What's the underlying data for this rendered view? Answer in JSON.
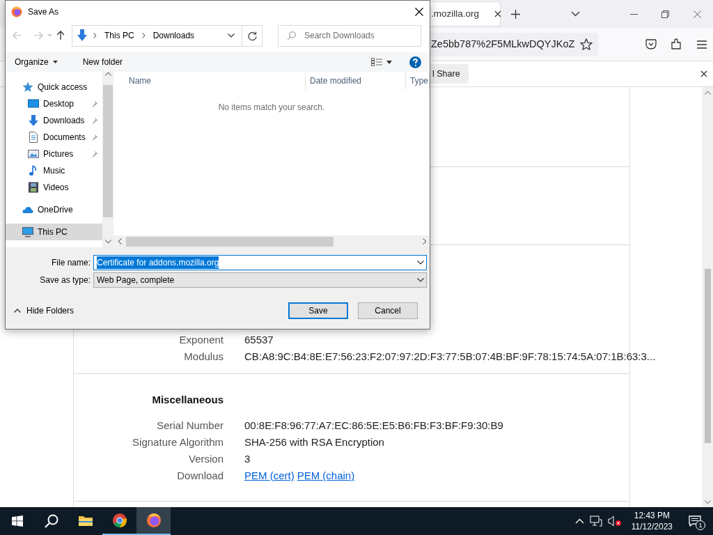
{
  "browser": {
    "tab": {
      "title": ".mozilla.org"
    },
    "url_fragment": "Ze5bb787%2F5MLkwDQYJKoZ",
    "notification": {
      "button": "l Share"
    }
  },
  "page": {
    "key_rows": [
      {
        "label": "Exponent",
        "value": "65537"
      },
      {
        "label": "Modulus",
        "value": "CB:A8:9C:B4:8E:E7:56:23:F2:07:97:2D:F3:77:5B:07:4B:BF:9F:78:15:74:5A:07:1B:63:3..."
      }
    ],
    "misc": {
      "heading": "Miscellaneous",
      "rows": [
        {
          "label": "Serial Number",
          "value": "00:8E:F8:96:77:A7:EC:86:5E:E5:B6:FB:F3:BF:F9:30:B9"
        },
        {
          "label": "Signature Algorithm",
          "value": "SHA-256 with RSA Encryption"
        },
        {
          "label": "Version",
          "value": "3"
        }
      ],
      "download": {
        "label": "Download",
        "links": [
          "PEM (cert)",
          "PEM (chain)"
        ]
      }
    }
  },
  "dialog": {
    "title": "Save As",
    "breadcrumb": [
      "This PC",
      "Downloads"
    ],
    "search": {
      "placeholder": "Search Downloads"
    },
    "toolbar": {
      "organize": "Organize",
      "new_folder": "New folder"
    },
    "nav": [
      {
        "label": "Quick access",
        "kind": "star",
        "selected": false,
        "children": [
          {
            "label": "Desktop",
            "kind": "desktop",
            "pinned": true,
            "selected": false
          },
          {
            "label": "Downloads",
            "kind": "download",
            "pinned": true,
            "selected": false
          },
          {
            "label": "Documents",
            "kind": "document",
            "pinned": true,
            "selected": false
          },
          {
            "label": "Pictures",
            "kind": "pictures",
            "pinned": true,
            "selected": false
          },
          {
            "label": "Music",
            "kind": "music",
            "pinned": false,
            "selected": false
          },
          {
            "label": "Videos",
            "kind": "videos",
            "pinned": false,
            "selected": false
          }
        ]
      },
      {
        "label": "OneDrive",
        "kind": "cloud",
        "selected": false
      },
      {
        "label": "This PC",
        "kind": "pc",
        "selected": true
      }
    ],
    "columns": [
      "Name",
      "Date modified",
      "Type"
    ],
    "empty_message": "No items match your search.",
    "file_name": {
      "label": "File name:",
      "value": "Certificate for addons.mozilla.org"
    },
    "save_type": {
      "label": "Save as type:",
      "value": "Web Page, complete"
    },
    "hide_folders": "Hide Folders",
    "buttons": [
      {
        "label": "Save",
        "default": true
      },
      {
        "label": "Cancel",
        "default": false
      }
    ]
  },
  "taskbar": {
    "apps": [
      {
        "kind": "explorer",
        "running": false,
        "selected": false
      },
      {
        "kind": "chrome",
        "running": true,
        "selected": false
      },
      {
        "kind": "firefox",
        "running": true,
        "selected": true
      }
    ],
    "time": "12:43 PM",
    "date": "11/12/2023",
    "notification_count": "1"
  }
}
